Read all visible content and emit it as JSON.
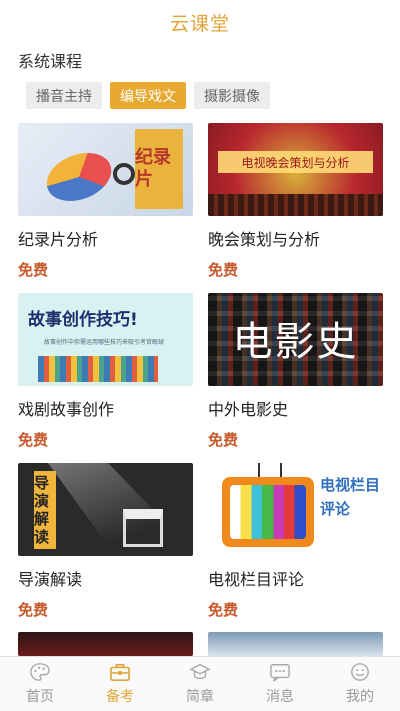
{
  "header": {
    "title": "云课堂"
  },
  "section": {
    "title": "系统课程"
  },
  "tabs": [
    {
      "label": "播音主持",
      "active": false
    },
    {
      "label": "编导戏文",
      "active": true
    },
    {
      "label": "摄影摄像",
      "active": false
    }
  ],
  "courses": [
    {
      "name": "纪录片分析",
      "price": "免费",
      "thumb_text": "纪录片"
    },
    {
      "name": "晚会策划与分析",
      "price": "免费",
      "thumb_text": "电视晚会策划与分析"
    },
    {
      "name": "戏剧故事创作",
      "price": "免费",
      "thumb_text": "故事创作技巧!",
      "thumb_sub": "故事创作中你需运用哪些技巧来吸引考官眼球"
    },
    {
      "name": "中外电影史",
      "price": "免费",
      "thumb_text": "电影史"
    },
    {
      "name": "导演解读",
      "price": "免费",
      "thumb_text": "导演解读"
    },
    {
      "name": "电视栏目评论",
      "price": "免费",
      "thumb_text": "电视栏目评论"
    }
  ],
  "tabbar": [
    {
      "label": "首页",
      "icon": "palette-icon",
      "active": false
    },
    {
      "label": "备考",
      "icon": "briefcase-icon",
      "active": true
    },
    {
      "label": "简章",
      "icon": "graduation-cap-icon",
      "active": false
    },
    {
      "label": "消息",
      "icon": "chat-bubble-icon",
      "active": false
    },
    {
      "label": "我的",
      "icon": "smile-icon",
      "active": false
    }
  ],
  "colors": {
    "accent": "#e0a63a",
    "price": "#c7592c",
    "tab_active_bg": "#e8a930"
  }
}
